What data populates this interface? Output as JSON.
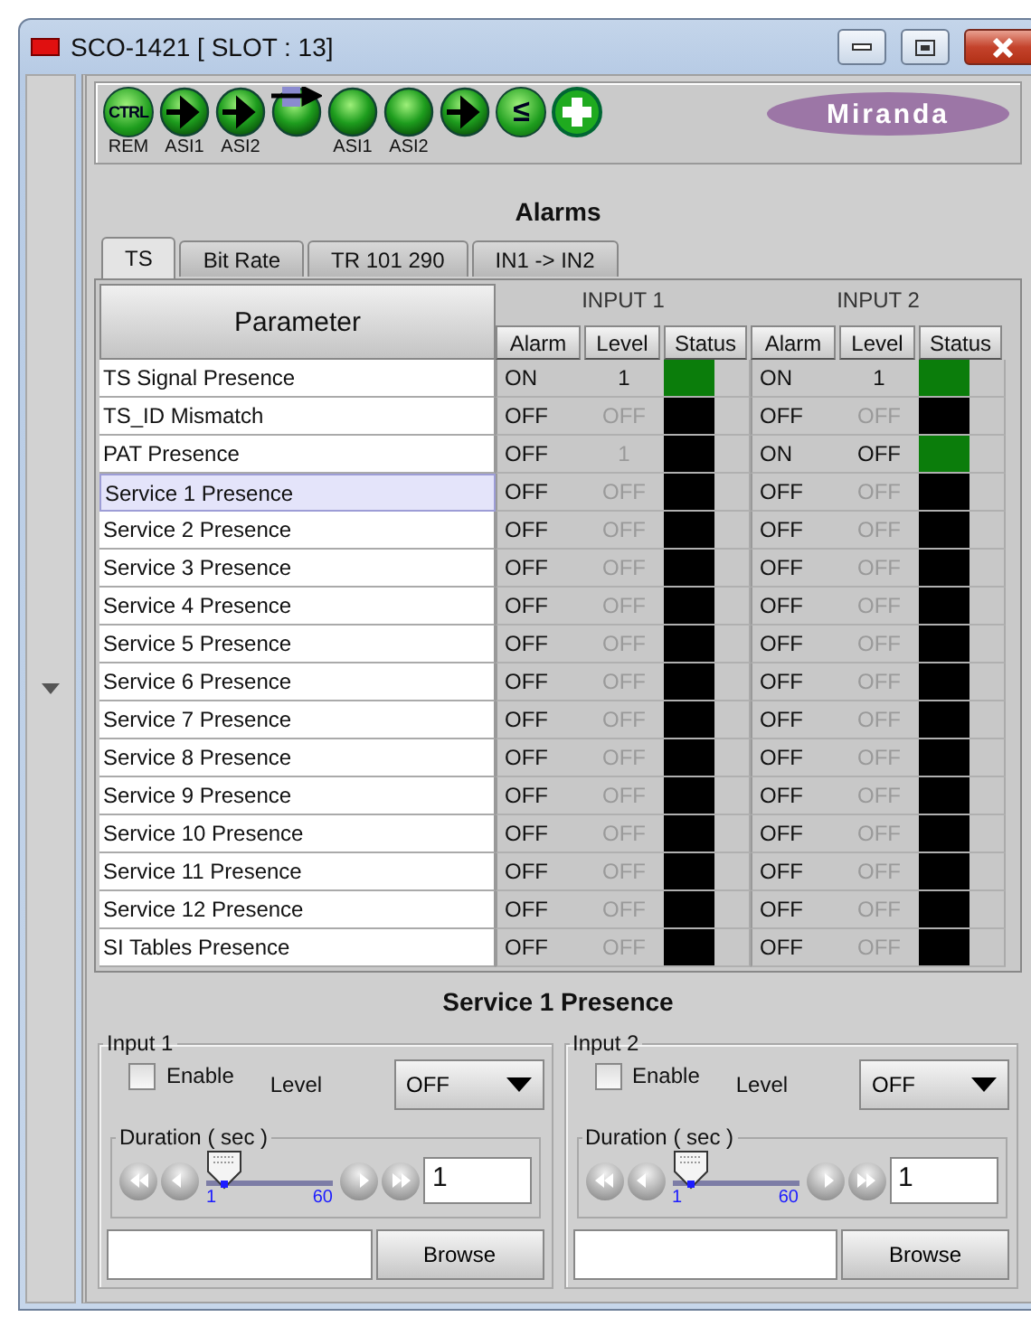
{
  "window": {
    "title": "SCO-1421 [ SLOT : 13]"
  },
  "toolbar": {
    "icons": [
      {
        "kind": "ctrl",
        "glyph": "CTRL",
        "label": "REM"
      },
      {
        "kind": "arrow",
        "label": "ASI1"
      },
      {
        "kind": "arrow",
        "label": "ASI2"
      },
      {
        "kind": "arrow-box"
      },
      {
        "kind": "led",
        "label": "ASI1"
      },
      {
        "kind": "led",
        "label": "ASI2"
      },
      {
        "kind": "arrow"
      },
      {
        "kind": "glyph",
        "glyph": "≤"
      },
      {
        "kind": "plus"
      }
    ],
    "logo": "Miranda"
  },
  "title": "Alarms",
  "tabs": [
    {
      "label": "TS",
      "selected": true
    },
    {
      "label": "Bit Rate",
      "selected": false
    },
    {
      "label": "TR 101 290",
      "selected": false
    },
    {
      "label": "IN1 -> IN2",
      "selected": false
    }
  ],
  "table": {
    "parameter_header": "Parameter",
    "inputs": [
      {
        "label": "INPUT 1",
        "columns": [
          "Alarm",
          "Level",
          "Status"
        ]
      },
      {
        "label": "INPUT 2",
        "columns": [
          "Alarm",
          "Level",
          "Status"
        ]
      }
    ],
    "rows": [
      {
        "parameter": "TS Signal Presence",
        "selected": false,
        "inputs": [
          {
            "alarm": "ON",
            "level": "1",
            "disabled": false,
            "color": "#0b7d0b"
          },
          {
            "alarm": "ON",
            "level": "1",
            "disabled": false,
            "color": "#0b7d0b"
          }
        ]
      },
      {
        "parameter": "TS_ID Mismatch",
        "selected": false,
        "inputs": [
          {
            "alarm": "OFF",
            "level": "OFF",
            "disabled": true,
            "color": "#000000"
          },
          {
            "alarm": "OFF",
            "level": "OFF",
            "disabled": true,
            "color": "#000000"
          }
        ]
      },
      {
        "parameter": "PAT Presence",
        "selected": false,
        "inputs": [
          {
            "alarm": "OFF",
            "level": "1",
            "disabled": true,
            "color": "#000000"
          },
          {
            "alarm": "ON",
            "level": "OFF",
            "disabled": false,
            "color": "#0b7d0b"
          }
        ]
      },
      {
        "parameter": "Service 1 Presence",
        "selected": true,
        "inputs": [
          {
            "alarm": "OFF",
            "level": "OFF",
            "disabled": true,
            "color": "#000000"
          },
          {
            "alarm": "OFF",
            "level": "OFF",
            "disabled": true,
            "color": "#000000"
          }
        ]
      },
      {
        "parameter": "Service 2 Presence",
        "selected": false,
        "inputs": [
          {
            "alarm": "OFF",
            "level": "OFF",
            "disabled": true,
            "color": "#000000"
          },
          {
            "alarm": "OFF",
            "level": "OFF",
            "disabled": true,
            "color": "#000000"
          }
        ]
      },
      {
        "parameter": "Service 3 Presence",
        "selected": false,
        "inputs": [
          {
            "alarm": "OFF",
            "level": "OFF",
            "disabled": true,
            "color": "#000000"
          },
          {
            "alarm": "OFF",
            "level": "OFF",
            "disabled": true,
            "color": "#000000"
          }
        ]
      },
      {
        "parameter": "Service 4 Presence",
        "selected": false,
        "inputs": [
          {
            "alarm": "OFF",
            "level": "OFF",
            "disabled": true,
            "color": "#000000"
          },
          {
            "alarm": "OFF",
            "level": "OFF",
            "disabled": true,
            "color": "#000000"
          }
        ]
      },
      {
        "parameter": "Service 5 Presence",
        "selected": false,
        "inputs": [
          {
            "alarm": "OFF",
            "level": "OFF",
            "disabled": true,
            "color": "#000000"
          },
          {
            "alarm": "OFF",
            "level": "OFF",
            "disabled": true,
            "color": "#000000"
          }
        ]
      },
      {
        "parameter": "Service 6 Presence",
        "selected": false,
        "inputs": [
          {
            "alarm": "OFF",
            "level": "OFF",
            "disabled": true,
            "color": "#000000"
          },
          {
            "alarm": "OFF",
            "level": "OFF",
            "disabled": true,
            "color": "#000000"
          }
        ]
      },
      {
        "parameter": "Service 7 Presence",
        "selected": false,
        "inputs": [
          {
            "alarm": "OFF",
            "level": "OFF",
            "disabled": true,
            "color": "#000000"
          },
          {
            "alarm": "OFF",
            "level": "OFF",
            "disabled": true,
            "color": "#000000"
          }
        ]
      },
      {
        "parameter": "Service 8 Presence",
        "selected": false,
        "inputs": [
          {
            "alarm": "OFF",
            "level": "OFF",
            "disabled": true,
            "color": "#000000"
          },
          {
            "alarm": "OFF",
            "level": "OFF",
            "disabled": true,
            "color": "#000000"
          }
        ]
      },
      {
        "parameter": "Service 9 Presence",
        "selected": false,
        "inputs": [
          {
            "alarm": "OFF",
            "level": "OFF",
            "disabled": true,
            "color": "#000000"
          },
          {
            "alarm": "OFF",
            "level": "OFF",
            "disabled": true,
            "color": "#000000"
          }
        ]
      },
      {
        "parameter": "Service 10 Presence",
        "selected": false,
        "inputs": [
          {
            "alarm": "OFF",
            "level": "OFF",
            "disabled": true,
            "color": "#000000"
          },
          {
            "alarm": "OFF",
            "level": "OFF",
            "disabled": true,
            "color": "#000000"
          }
        ]
      },
      {
        "parameter": "Service 11 Presence",
        "selected": false,
        "inputs": [
          {
            "alarm": "OFF",
            "level": "OFF",
            "disabled": true,
            "color": "#000000"
          },
          {
            "alarm": "OFF",
            "level": "OFF",
            "disabled": true,
            "color": "#000000"
          }
        ]
      },
      {
        "parameter": "Service 12 Presence",
        "selected": false,
        "inputs": [
          {
            "alarm": "OFF",
            "level": "OFF",
            "disabled": true,
            "color": "#000000"
          },
          {
            "alarm": "OFF",
            "level": "OFF",
            "disabled": true,
            "color": "#000000"
          }
        ]
      },
      {
        "parameter": "SI Tables Presence",
        "selected": false,
        "inputs": [
          {
            "alarm": "OFF",
            "level": "OFF",
            "disabled": true,
            "color": "#000000"
          },
          {
            "alarm": "OFF",
            "level": "OFF",
            "disabled": true,
            "color": "#000000"
          }
        ]
      }
    ]
  },
  "detail": {
    "title": "Service 1 Presence",
    "inputs": [
      {
        "legend": "Input 1",
        "enable": {
          "label": "Enable",
          "checked": false
        },
        "level_label": "Level",
        "level_value": "OFF",
        "duration": {
          "label": "Duration ( sec )",
          "min": "1",
          "max": "60",
          "level": 0,
          "value": "1"
        },
        "browse": "Browse"
      },
      {
        "legend": "Input 2",
        "enable": {
          "label": "Enable",
          "checked": false
        },
        "level_label": "Level",
        "level_value": "OFF",
        "duration": {
          "label": "Duration ( sec )",
          "min": "1",
          "max": "60",
          "level": 0,
          "value": "1"
        },
        "browse": "Browse"
      }
    ]
  }
}
